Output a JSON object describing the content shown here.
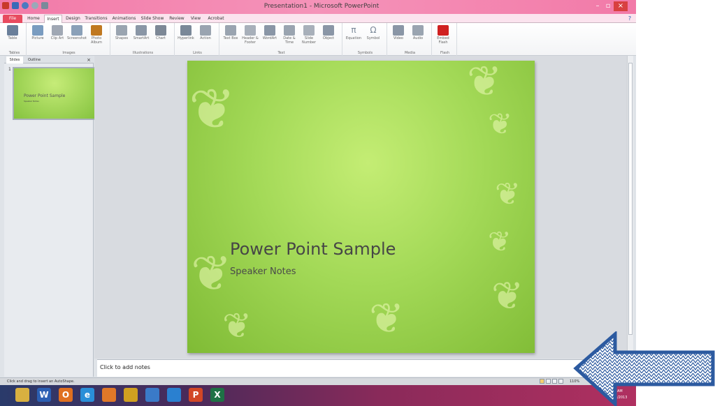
{
  "window": {
    "title": "Presentation1 - Microsoft PowerPoint",
    "help_glyph": "?"
  },
  "tabs": [
    "File",
    "Home",
    "Insert",
    "Design",
    "Transitions",
    "Animations",
    "Slide Show",
    "Review",
    "View",
    "Acrobat"
  ],
  "ribbon": {
    "groups": [
      {
        "name": "Tables",
        "buttons": [
          {
            "label": "Table",
            "icon": "table-icon",
            "color": "#6a7f9a"
          }
        ]
      },
      {
        "name": "Images",
        "buttons": [
          {
            "label": "Picture",
            "icon": "picture-icon",
            "color": "#7a9cc0"
          },
          {
            "label": "Clip Art",
            "icon": "clip-art-icon",
            "color": "#a0a8b4"
          },
          {
            "label": "Screenshot",
            "icon": "screenshot-icon",
            "color": "#8aa0b8"
          },
          {
            "label": "Photo Album",
            "icon": "photo-album-icon",
            "color": "#c07820"
          }
        ]
      },
      {
        "name": "Illustrations",
        "buttons": [
          {
            "label": "Shapes",
            "icon": "shapes-icon",
            "color": "#9aa4b0"
          },
          {
            "label": "SmartArt",
            "icon": "smartart-icon",
            "color": "#8a96a6"
          },
          {
            "label": "Chart",
            "icon": "chart-icon",
            "color": "#7d8896"
          }
        ]
      },
      {
        "name": "Links",
        "buttons": [
          {
            "label": "Hyperlink",
            "icon": "hyperlink-icon",
            "color": "#7a8898"
          },
          {
            "label": "Action",
            "icon": "action-icon",
            "color": "#9aa4b0"
          }
        ]
      },
      {
        "name": "Text",
        "buttons": [
          {
            "label": "Text Box",
            "icon": "text-box-icon",
            "color": "#9aa4b0"
          },
          {
            "label": "Header & Footer",
            "icon": "header-footer-icon",
            "color": "#a8b0ba"
          },
          {
            "label": "WordArt",
            "icon": "wordart-icon",
            "color": "#8a96a6"
          },
          {
            "label": "Date & Time",
            "icon": "date-time-icon",
            "color": "#9aa4b0"
          },
          {
            "label": "Slide Number",
            "icon": "slide-number-icon",
            "color": "#a8b0ba"
          },
          {
            "label": "Object",
            "icon": "object-icon",
            "color": "#8a96a6"
          }
        ]
      },
      {
        "name": "Symbols",
        "buttons": [
          {
            "label": "Equation",
            "icon": "equation-icon",
            "glyph": "π",
            "color": "#7a8898"
          },
          {
            "label": "Symbol",
            "icon": "symbol-icon",
            "glyph": "Ω",
            "color": "#7a8898"
          }
        ]
      },
      {
        "name": "Media",
        "buttons": [
          {
            "label": "Video",
            "icon": "video-icon",
            "color": "#8a96a6"
          },
          {
            "label": "Audio",
            "icon": "audio-icon",
            "color": "#9aa4b0"
          }
        ]
      },
      {
        "name": "Flash",
        "buttons": [
          {
            "label": "Embed Flash",
            "icon": "embed-flash-icon",
            "color": "#d02020"
          }
        ]
      }
    ]
  },
  "slides_pane": {
    "tabs": [
      "Slides",
      "Outline"
    ],
    "close_glyph": "×",
    "thumb_number": "1",
    "thumb_title": "Power Point Sample",
    "thumb_subtitle": "Speaker Notes"
  },
  "slide": {
    "title": "Power Point Sample",
    "subtitle": "Speaker Notes",
    "background": "#a3d957"
  },
  "notes": {
    "placeholder": "Click to add notes"
  },
  "status": {
    "text": "Click and drag to insert an AutoShape.",
    "zoom": "110%"
  },
  "taskbar": {
    "apps": [
      {
        "icon": "file-explorer-icon",
        "color": "#d8b040"
      },
      {
        "icon": "word-icon",
        "glyph": "W",
        "color": "#2b5fb3"
      },
      {
        "icon": "outlook-icon",
        "glyph": "O",
        "color": "#e07020"
      },
      {
        "icon": "internet-explorer-icon",
        "glyph": "e",
        "color": "#2a8fd8"
      },
      {
        "icon": "firefox-icon",
        "color": "#e07828"
      },
      {
        "icon": "chrome-icon",
        "color": "#d0a020"
      },
      {
        "icon": "desktop-app-icon",
        "color": "#3a7ac8"
      },
      {
        "icon": "app-icon",
        "color": "#2a80d0"
      },
      {
        "icon": "powerpoint-icon",
        "glyph": "P",
        "color": "#d24726"
      },
      {
        "icon": "excel-icon",
        "glyph": "X",
        "color": "#1e7145"
      }
    ],
    "clock_time": "AM",
    "clock_date": "/2013"
  },
  "overlay": {
    "arrow_color": "#2c5aa0",
    "arrow_icon": "left-arrow-icon"
  }
}
